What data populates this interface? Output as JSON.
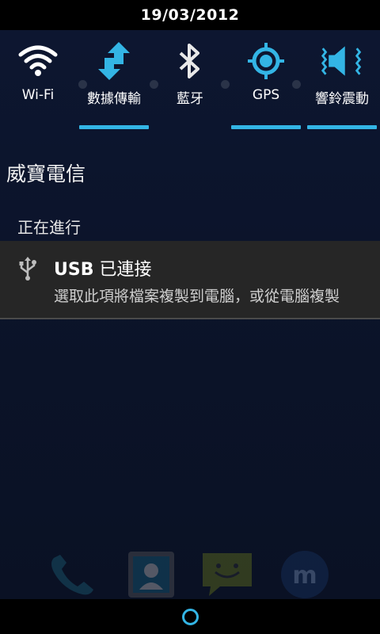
{
  "status_bar": {
    "date": "19/03/2012"
  },
  "accent_color": "#33b5e5",
  "toggles": [
    {
      "label": "Wi-Fi",
      "icon": "wifi-icon",
      "active": false
    },
    {
      "label": "數據傳輸",
      "icon": "data-transfer-icon",
      "active": true
    },
    {
      "label": "藍牙",
      "icon": "bluetooth-icon",
      "active": false
    },
    {
      "label": "GPS",
      "icon": "gps-icon",
      "active": true
    },
    {
      "label": "響鈴震動",
      "icon": "ring-vibrate-icon",
      "active": true
    }
  ],
  "carrier": "威寶電信",
  "ongoing_header": "正在進行",
  "notification": {
    "icon": "usb-icon",
    "title_bold": "USB",
    "title_rest": " 已連接",
    "text": "選取此項將檔案複製到電腦，或從電腦複製"
  },
  "dock": [
    {
      "icon": "phone-icon"
    },
    {
      "icon": "contacts-icon"
    },
    {
      "icon": "messaging-icon"
    },
    {
      "icon": "m-app-icon"
    }
  ],
  "nav": {
    "icon": "home-ring-icon"
  }
}
